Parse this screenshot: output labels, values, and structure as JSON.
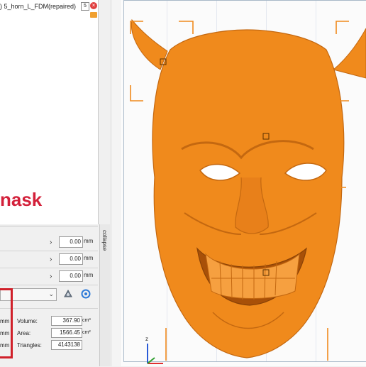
{
  "object_tree": {
    "item_label": ") 5_horn_L_FDM(repaired)",
    "count": "5"
  },
  "caption": "nask",
  "panel": {
    "collapse_label": "collapse",
    "rows": [
      {
        "value": "0.00",
        "unit": "mm"
      },
      {
        "value": "0.00",
        "unit": "mm"
      },
      {
        "value": "0.00",
        "unit": "mm"
      }
    ],
    "stats": [
      {
        "left_unit": "mm",
        "label": "Volume:",
        "value": "367.90",
        "unit": "cm³"
      },
      {
        "left_unit": "mm",
        "label": "Area:",
        "value": "1566.45",
        "unit": "cm²"
      },
      {
        "left_unit": "mm",
        "label": "Triangles:",
        "value": "4143138",
        "unit": ""
      }
    ]
  },
  "viewport": {
    "axis_label": "z",
    "model_color": "#f08a1c",
    "selection_color": "#f08a1c",
    "axis_colors": {
      "z": "#2a5bd7",
      "x": "#e03030",
      "y": "#30a030"
    }
  },
  "icons": {
    "close": "close-icon",
    "gear": "gear-icon",
    "refresh": "refresh-icon",
    "dropdown": "chevron-down-icon"
  }
}
